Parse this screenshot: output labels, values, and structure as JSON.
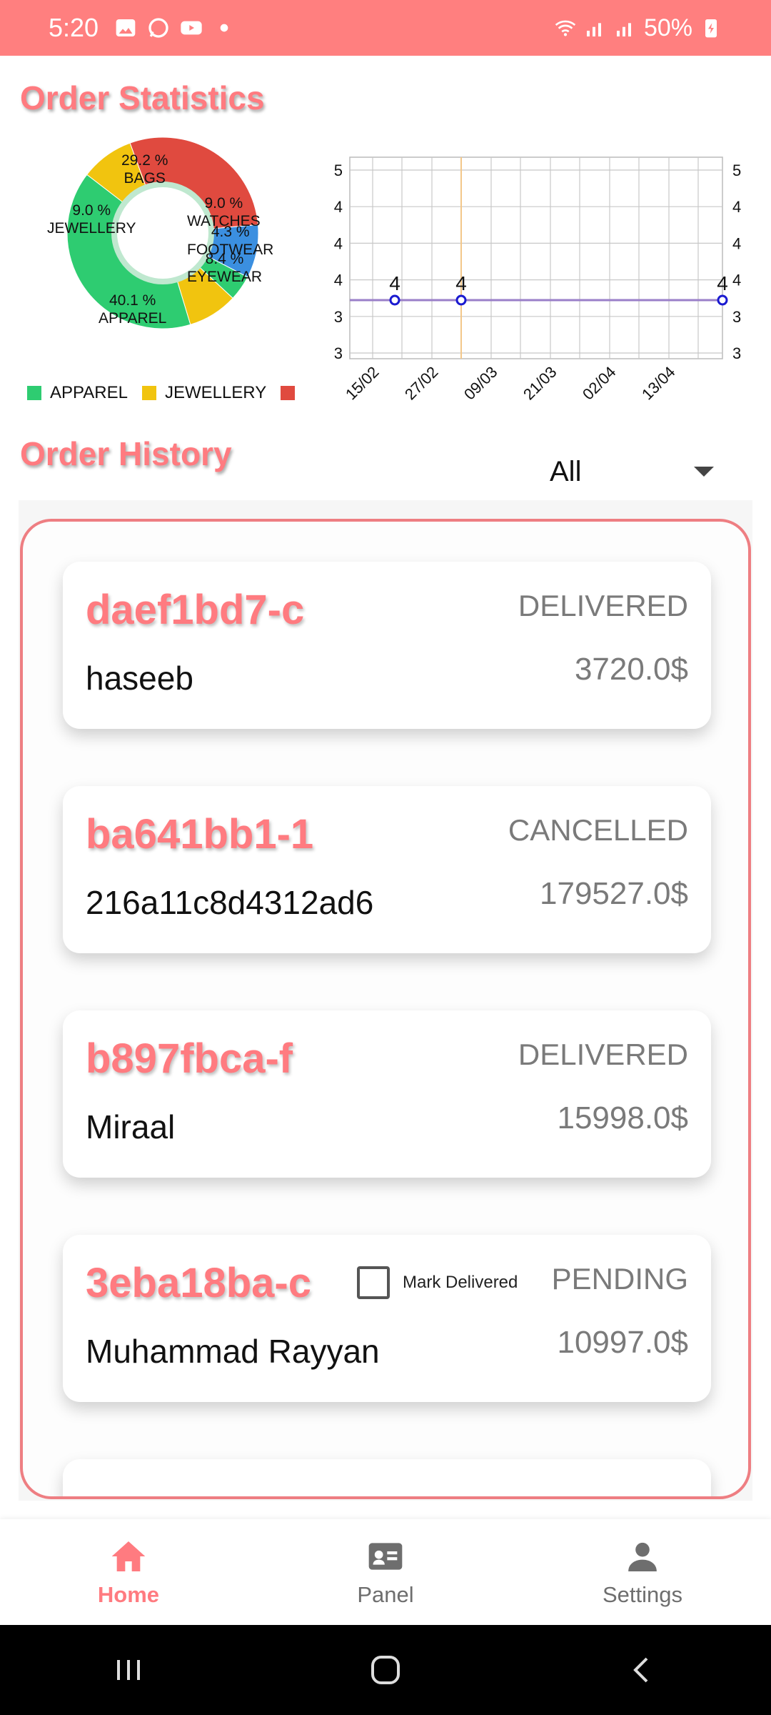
{
  "status_bar": {
    "time": "5:20",
    "battery": "50%"
  },
  "stats": {
    "title": "Order Statistics"
  },
  "pie": {
    "slices": [
      {
        "name": "BAGS",
        "percent_label": "29.2 %",
        "value": 29.2,
        "color": "#e04a3f"
      },
      {
        "name": "WATCHES",
        "percent_label": "9.0 %",
        "value": 9.0,
        "color": "#3b8fe0"
      },
      {
        "name": "FOOTWEAR",
        "percent_label": "4.3 %",
        "value": 4.3,
        "color": "#2ecc71"
      },
      {
        "name": "EYEWEAR",
        "percent_label": "8.4 %",
        "value": 8.4,
        "color": "#f1c40f"
      },
      {
        "name": "APPAREL",
        "percent_label": "40.1 %",
        "value": 40.1,
        "color": "#2ecc71"
      },
      {
        "name": "JEWELLERY",
        "percent_label": "9.0 %",
        "value": 9.0,
        "color": "#f1c40f"
      }
    ],
    "legend": [
      {
        "name": "APPAREL",
        "color": "#2ecc71"
      },
      {
        "name": "JEWELLERY",
        "color": "#f1c40f"
      },
      {
        "name": "",
        "color": "#e04a3f"
      }
    ]
  },
  "chart_data": {
    "type": "line",
    "x": [
      "15/02",
      "27/02",
      "09/03",
      "21/03",
      "02/04",
      "13/04"
    ],
    "y_tick_labels_left": [
      "5",
      "4",
      "4",
      "4",
      "3",
      "3"
    ],
    "y_tick_labels_right": [
      "5",
      "4",
      "4",
      "4",
      "3",
      "3"
    ],
    "series": [
      {
        "points": [
          {
            "x": "18/02",
            "y": 4,
            "label": "4"
          },
          {
            "x": "02/03",
            "y": 4,
            "label": "4"
          },
          {
            "x": "18/04",
            "y": 4,
            "label": "4"
          }
        ]
      }
    ],
    "ylim": [
      3,
      5
    ],
    "grid": true,
    "line_color": "#9a7fc8",
    "highlight_line_color": "#f3c78a"
  },
  "history": {
    "title": "Order History",
    "filter_value": "All"
  },
  "orders": [
    {
      "id": "daef1bd7-c",
      "name": "haseeb",
      "status": "DELIVERED",
      "amount": "3720.0$"
    },
    {
      "id": "ba641bb1-1",
      "name": "216a11c8d4312ad6",
      "status": "CANCELLED",
      "amount": "179527.0$"
    },
    {
      "id": "b897fbca-f",
      "name": "Miraal",
      "status": "DELIVERED",
      "amount": "15998.0$"
    },
    {
      "id": "3eba18ba-c",
      "name": "Muhammad Rayyan",
      "status": "PENDING",
      "amount": "10997.0$",
      "mark_label": "Mark Delivered"
    }
  ],
  "nav": {
    "home": "Home",
    "panel": "Panel",
    "settings": "Settings"
  }
}
